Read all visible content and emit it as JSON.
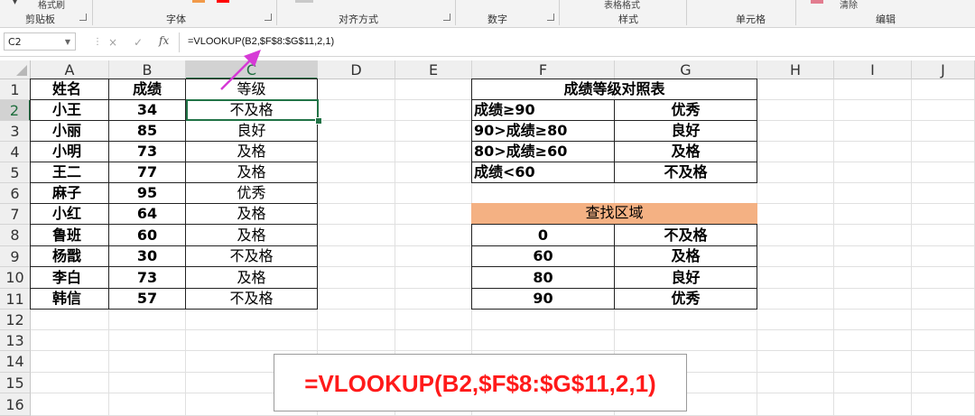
{
  "ribbon": {
    "groups": [
      {
        "label": "剪贴板"
      },
      {
        "label": "字体"
      },
      {
        "label": "对齐方式"
      },
      {
        "label": "数字"
      },
      {
        "label": "样式"
      },
      {
        "label": "单元格"
      },
      {
        "label": "编辑"
      }
    ],
    "top_fragments": {
      "format_painter": "格式刷",
      "table_format": "表格格式",
      "clear": "清除"
    }
  },
  "formula_bar": {
    "name_box": "C2",
    "cancel_icon": "×",
    "confirm_icon": "✓",
    "fx_label": "fx",
    "formula": "=VLOOKUP(B2,$F$8:$G$11,2,1)"
  },
  "columns": [
    "A",
    "B",
    "C",
    "D",
    "E",
    "F",
    "G",
    "H",
    "I",
    "J"
  ],
  "rows": [
    "1",
    "2",
    "3",
    "4",
    "5",
    "6",
    "7",
    "8",
    "9",
    "10",
    "11",
    "12",
    "13",
    "14",
    "15",
    "16"
  ],
  "selected_cell": "C2",
  "table_main": {
    "headers": [
      "姓名",
      "成绩",
      "等级"
    ],
    "rows": [
      [
        "小王",
        "34",
        "不及格"
      ],
      [
        "小丽",
        "85",
        "良好"
      ],
      [
        "小明",
        "73",
        "及格"
      ],
      [
        "王二",
        "77",
        "及格"
      ],
      [
        "麻子",
        "95",
        "优秀"
      ],
      [
        "小红",
        "64",
        "及格"
      ],
      [
        "鲁班",
        "60",
        "及格"
      ],
      [
        "杨戬",
        "30",
        "不及格"
      ],
      [
        "李白",
        "73",
        "及格"
      ],
      [
        "韩信",
        "57",
        "不及格"
      ]
    ]
  },
  "table_reference": {
    "title": "成绩等级对照表",
    "rows": [
      [
        "成绩≥90",
        "优秀"
      ],
      [
        "90>成绩≥80",
        "良好"
      ],
      [
        "80>成绩≥60",
        "及格"
      ],
      [
        "成绩<60",
        "不及格"
      ]
    ]
  },
  "table_lookup": {
    "title": "查找区域",
    "title_color": "#F4B183",
    "rows": [
      [
        "0",
        "不及格"
      ],
      [
        "60",
        "及格"
      ],
      [
        "80",
        "良好"
      ],
      [
        "90",
        "优秀"
      ]
    ]
  },
  "annotation": {
    "formula_text": "=VLOOKUP(B2,$F$8:$G$11,2,1)",
    "text_color": "#FF1A1A",
    "arrow_color": "#D63AD6"
  }
}
